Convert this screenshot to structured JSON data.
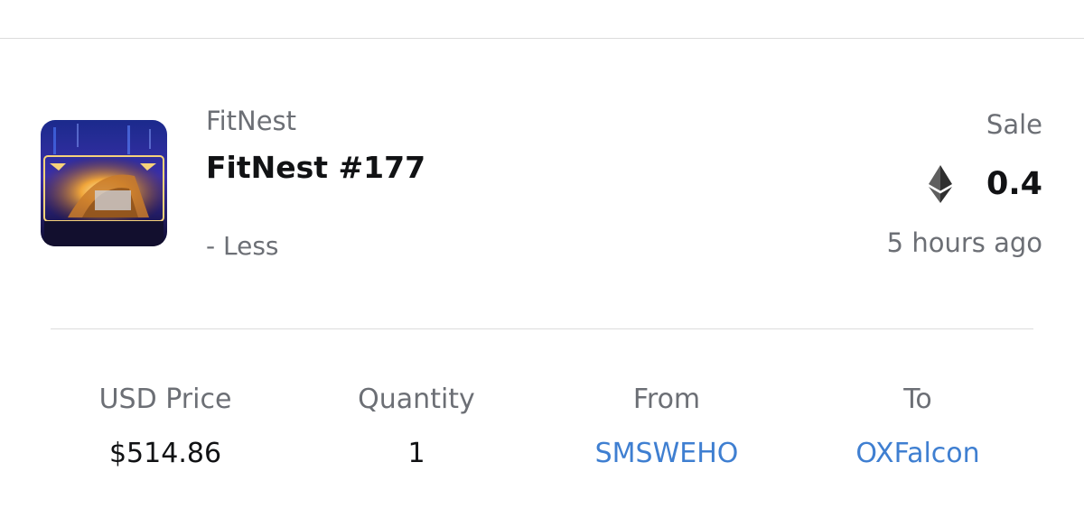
{
  "item": {
    "collection": "FitNest",
    "title": "FitNest #177",
    "toggle_label": "- Less"
  },
  "event": {
    "type": "Sale",
    "currency_icon": "ethereum-icon",
    "price": "0.4",
    "time_ago": "5 hours ago"
  },
  "details": {
    "usd_price_label": "USD Price",
    "usd_price_value": "$514.86",
    "quantity_label": "Quantity",
    "quantity_value": "1",
    "from_label": "From",
    "from_value": "SMSWEHO",
    "to_label": "To",
    "to_value": "OXFalcon"
  },
  "colors": {
    "link": "#3f7fd1",
    "muted_text": "#6c6f75",
    "primary_text": "#111214"
  }
}
